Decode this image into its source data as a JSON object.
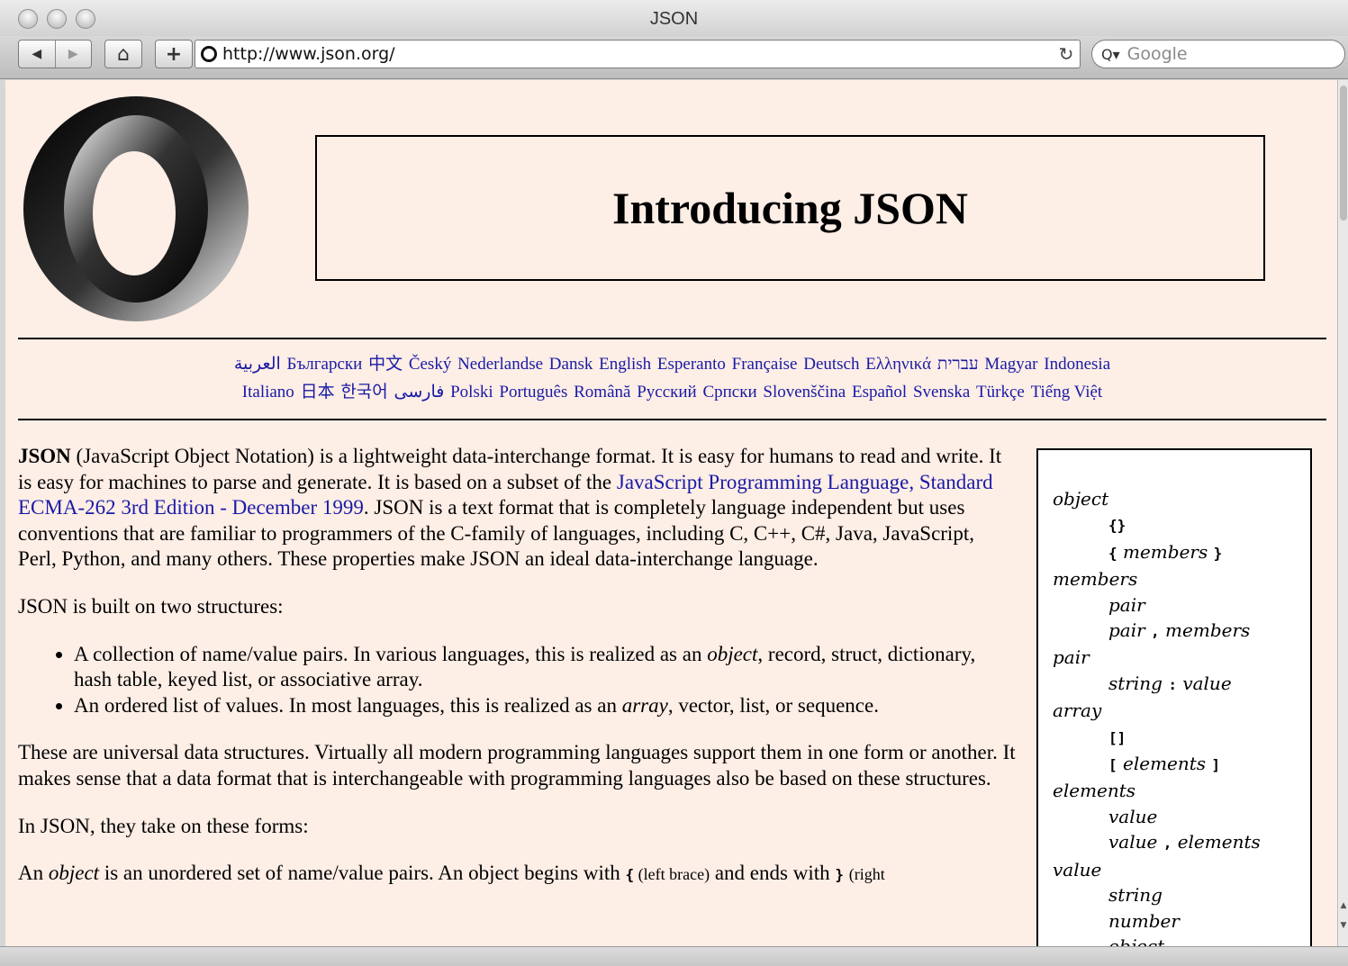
{
  "window": {
    "title": "JSON"
  },
  "toolbar": {
    "back_glyph": "◀",
    "forward_glyph": "▶",
    "home_glyph": "⌂",
    "add_glyph": "+",
    "url": "http://www.json.org/",
    "reload_glyph": "↻",
    "search_placeholder": "Google",
    "search_glyph": "Q▾"
  },
  "page": {
    "title": "Introducing JSON",
    "languages_line1": [
      "العربية",
      "Български",
      "中文",
      "Český",
      "Nederlandse",
      "Dansk",
      "English",
      "Esperanto",
      "Française",
      "Deutsch",
      "Ελληνικά",
      "עברית",
      "Magyar",
      "Indonesia"
    ],
    "languages_line2": [
      "Italiano",
      "日本",
      "한국어",
      "فارسی",
      "Polski",
      "Português",
      "Română",
      "Русский",
      "Српски",
      "Slovenščina",
      "Español",
      "Svenska",
      "Türkçe",
      "Tiếng Việt"
    ],
    "intro": {
      "bold": "JSON",
      "text1": " (JavaScript Object Notation) is a lightweight data-interchange format. It is easy for humans to read and write. It is easy for machines to parse and generate. It is based on a subset of the ",
      "link1": "JavaScript Programming Language",
      "sep": ", ",
      "link2": "Standard ECMA-262 3rd Edition - December 1999",
      "text2": ". JSON is a text format that is completely language independent but uses conventions that are familiar to programmers of the C-family of languages, including C, C++, C#, Java, JavaScript, Perl, Python, and many others. These properties make JSON an ideal data-interchange language."
    },
    "built_on": "JSON is built on two structures:",
    "bullet1": {
      "a": "A collection of name/value pairs. In various languages, this is realized as an ",
      "em": "object",
      "b": ", record, struct, dictionary, hash table, keyed list, or associative array."
    },
    "bullet2": {
      "a": "An ordered list of values. In most languages, this is realized as an ",
      "em": "array",
      "b": ", vector, list, or sequence."
    },
    "universal": "These are universal data structures. Virtually all modern programming languages support them in one form or another. It makes sense that a data format that is interchangeable with programming languages also be based on these structures.",
    "forms": "In JSON, they take on these forms:",
    "object_para": {
      "a": "An ",
      "em": "object",
      "b": " is an unordered set of name/value pairs. An object begins with ",
      "tok1": "{",
      "c": " (left brace)",
      "d": " and ends with ",
      "tok2": "}",
      "e": " (right"
    }
  },
  "grammar": {
    "object": "object",
    "object_r1": "{}",
    "object_r2_open": "{",
    "object_r2_mid": "members",
    "object_r2_close": "}",
    "members": "members",
    "members_r1": "pair",
    "members_r2_a": "pair",
    "comma": ",",
    "members_r2_b": "members",
    "pair": "pair",
    "pair_r1_a": "string",
    "colon": ":",
    "pair_r1_b": "value",
    "array": "array",
    "array_r1": "[]",
    "array_r2_open": "[",
    "array_r2_mid": "elements",
    "array_r2_close": "]",
    "elements": "elements",
    "elements_r1": "value",
    "elements_r2_a": "value",
    "elements_r2_b": "elements",
    "value": "value",
    "value_r1": "string",
    "value_r2": "number",
    "value_r3": "object"
  }
}
